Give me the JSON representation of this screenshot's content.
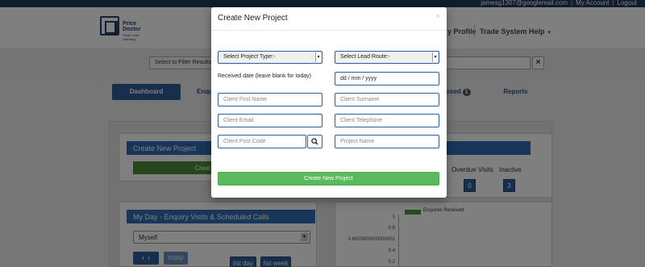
{
  "topbar": {
    "email": "jamesg1307@googlemail.com",
    "my_account": "My Account",
    "logout": "Logout"
  },
  "header": {
    "logo_line1": "Price",
    "logo_line2": "Doctor",
    "logo_tagline": "Trade Lead Handling",
    "nav_profile": "y Profile",
    "nav_help": "Trade System Help"
  },
  "filter": {
    "select_label": "Select to Filter Results"
  },
  "nav": {
    "dashboard": "Dashboard",
    "enquiries": "Enqui",
    "closed": "osed",
    "closed_count": "1",
    "reports": "Reports"
  },
  "left_panel": {
    "create_project_title": "Create New Project",
    "create_button_fragment": "Creat",
    "my_day_title": "My Day - Enquiry Visits & Scheduled Calls",
    "my_day_select": "Myself",
    "today_button": "today",
    "list_day": "list day",
    "list_week": "list week"
  },
  "stats": {
    "overdue_label": "Overdue Visits",
    "overdue_value": "0",
    "inactive_label": "Inactive",
    "inactive_value": "3"
  },
  "chart_data": {
    "type": "bar",
    "series": [
      {
        "name": "Enquires Received",
        "values": []
      }
    ],
    "y_ticks": [
      "1",
      "0.8",
      "0.6000000000000001",
      "0.4",
      "0.2"
    ],
    "legend_color": "#4a9a3a"
  },
  "modal": {
    "title": "Create New Project",
    "close_glyph": "×",
    "project_type": "Select Project Type:-",
    "lead_route": "Select Lead Route:-",
    "received_date_label": "Received date (leave blank for today)",
    "date_value": "dd / mm / yyyy",
    "client_first_name": "Client First Name",
    "client_surname": "Client Surname",
    "client_email": "Client Email",
    "client_telephone": "Client Telephone",
    "client_post_code": "Client Post Code",
    "project_name": "Project Name",
    "submit": "Create New Project"
  },
  "colors": {
    "accent_blue": "#2f6db3",
    "submit_green": "#5cb85c",
    "topbar": "#1f3b5a"
  }
}
